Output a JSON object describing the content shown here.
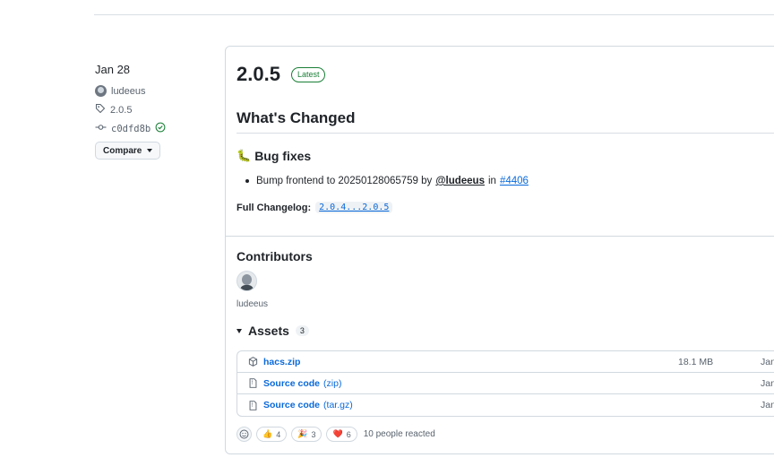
{
  "meta": {
    "date": "Jan 28",
    "author": "ludeeus",
    "tag": "2.0.5",
    "commit": "c0dfd8b",
    "compare_label": "Compare"
  },
  "release": {
    "version": "2.0.5",
    "latest_badge": "Latest",
    "whats_changed": "What's Changed",
    "bug_fixes_heading": "Bug fixes",
    "change_item": {
      "text": "Bump frontend to 20250128065759 by",
      "mention": "@ludeeus",
      "in_word": "in",
      "pr": "#4406"
    },
    "full_changelog_label": "Full Changelog:",
    "full_changelog_link": "2.0.4...2.0.5"
  },
  "contributors": {
    "heading": "Contributors",
    "names": [
      "ludeeus"
    ]
  },
  "assets": {
    "heading": "Assets",
    "count": "3",
    "items": [
      {
        "name": "hacs.zip",
        "suffix": "",
        "size": "18.1 MB",
        "date": "Jan"
      },
      {
        "name": "Source code",
        "suffix": "(zip)",
        "size": "",
        "date": "Jan"
      },
      {
        "name": "Source code",
        "suffix": "(tar.gz)",
        "size": "",
        "date": "Jan"
      }
    ]
  },
  "reactions": {
    "items": [
      {
        "emoji": "👍",
        "count": "4"
      },
      {
        "emoji": "🎉",
        "count": "3"
      },
      {
        "emoji": "❤️",
        "count": "6"
      }
    ],
    "summary": "10 people reacted"
  },
  "colors": {
    "link": "#0969da",
    "latest_green": "#1a7f37",
    "border": "#d1d9e0"
  }
}
